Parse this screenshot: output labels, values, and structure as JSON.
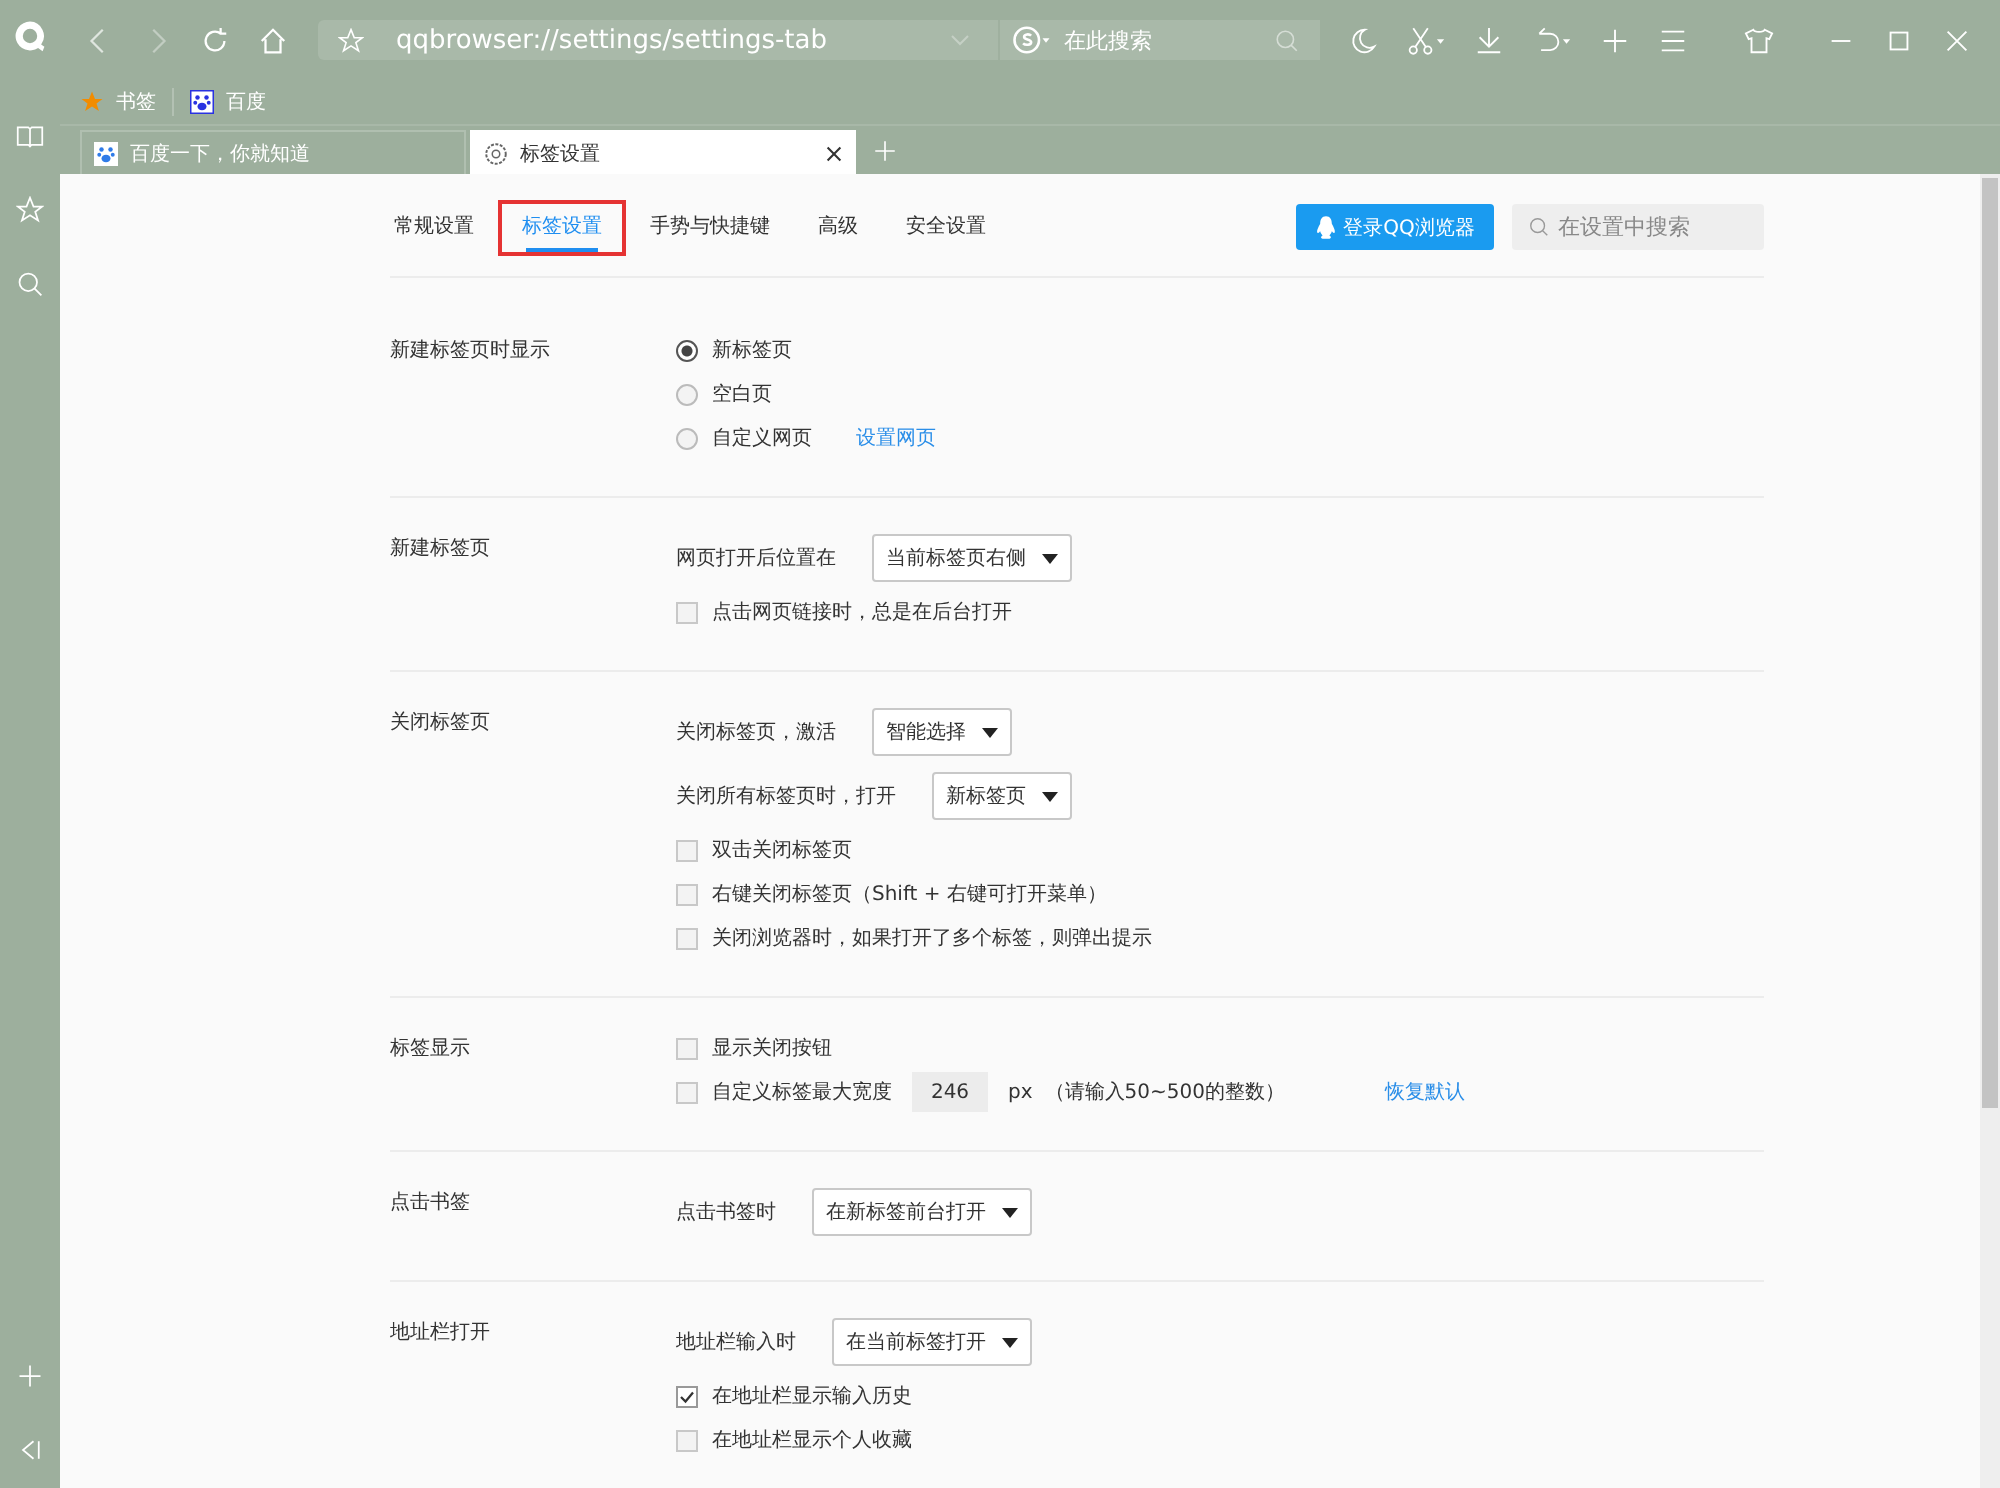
{
  "window": {
    "address": "qqbrowser://settings/settings-tab",
    "search_placeholder": "在此搜索"
  },
  "bookmarks": [
    {
      "label": "书签",
      "kind": "folder"
    },
    {
      "label": "百度",
      "kind": "site"
    }
  ],
  "tabs": [
    {
      "title": "百度一下，你就知道",
      "kind": "site",
      "selected": false
    },
    {
      "title": "标签设置",
      "kind": "settings",
      "selected": true
    }
  ],
  "settings_nav": [
    {
      "label": "常规设置",
      "selected": false,
      "highlighted": false
    },
    {
      "label": "标签设置",
      "selected": true,
      "highlighted": true
    },
    {
      "label": "手势与快捷键",
      "selected": false,
      "highlighted": false
    },
    {
      "label": "高级",
      "selected": false,
      "highlighted": false
    },
    {
      "label": "安全设置",
      "selected": false,
      "highlighted": false
    }
  ],
  "login_button": "登录QQ浏览器",
  "settings_search": {
    "placeholder": "在设置中搜索"
  },
  "sections": [
    {
      "label": "新建标签页时显示",
      "items": [
        {
          "kind": "radio",
          "label": "新标签页",
          "selected": true
        },
        {
          "kind": "radio",
          "label": "空白页",
          "selected": false
        },
        {
          "kind": "radio",
          "label": "自定义网页",
          "selected": false,
          "link": "设置网页"
        }
      ]
    },
    {
      "label": "新建标签页",
      "items": [
        {
          "kind": "select",
          "label": "网页打开后位置在",
          "value": "当前标签页右侧"
        },
        {
          "kind": "checkbox",
          "label": "点击网页链接时，总是在后台打开",
          "checked": false
        }
      ]
    },
    {
      "label": "关闭标签页",
      "items": [
        {
          "kind": "select",
          "label": "关闭标签页，激活",
          "value": "智能选择"
        },
        {
          "kind": "select",
          "label": "关闭所有标签页时，打开",
          "value": "新标签页"
        },
        {
          "kind": "checkbox",
          "label": "双击关闭标签页",
          "checked": false
        },
        {
          "kind": "checkbox",
          "label": "右键关闭标签页（Shift + 右键可打开菜单）",
          "checked": false
        },
        {
          "kind": "checkbox",
          "label": "关闭浏览器时，如果打开了多个标签，则弹出提示",
          "checked": false
        }
      ]
    },
    {
      "label": "标签显示",
      "items": [
        {
          "kind": "checkbox",
          "label": "显示关闭按钮",
          "checked": false
        },
        {
          "kind": "width",
          "label": "自定义标签最大宽度",
          "checked": false,
          "value": "246",
          "unit": "px",
          "hint": "（请输入50~500的整数）",
          "link": "恢复默认"
        }
      ]
    },
    {
      "label": "点击书签",
      "items": [
        {
          "kind": "select",
          "label": "点击书签时",
          "value": "在新标签前台打开"
        }
      ]
    },
    {
      "label": "地址栏打开",
      "items": [
        {
          "kind": "select",
          "label": "地址栏输入时",
          "value": "在当前标签打开"
        },
        {
          "kind": "checkbox",
          "label": "在地址栏显示输入历史",
          "checked": true
        },
        {
          "kind": "checkbox",
          "label": "在地址栏显示个人收藏",
          "checked": false
        }
      ]
    }
  ]
}
